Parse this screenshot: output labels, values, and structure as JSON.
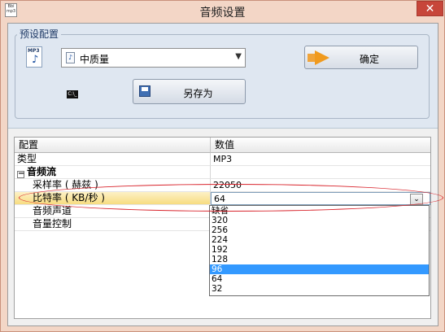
{
  "window": {
    "title": "音频设置",
    "app_icon_text": "Bbi mp3",
    "close_symbol": "✕"
  },
  "preset": {
    "group_label": "预设配置",
    "mp3_icon_text": "MP3",
    "selected": "中质量",
    "confirm_label": "确定",
    "save_as_label": "另存为",
    "cmd_icon_text": "C:\\_"
  },
  "grid": {
    "headers": {
      "config": "配置",
      "value": "数值"
    },
    "rows": [
      {
        "label": "类型",
        "value": "MP3"
      },
      {
        "label": "音频流",
        "value": "",
        "expander": "−"
      },
      {
        "label": "采样率 ( 赫兹 )",
        "value": "22050"
      },
      {
        "label": "比特率 ( KB/秒 )",
        "value": "64"
      },
      {
        "label": "音频声道",
        "value": ""
      },
      {
        "label": "音量控制",
        "value": ""
      }
    ]
  },
  "bitrate_dropdown": {
    "options": [
      "缺省",
      "320",
      "256",
      "224",
      "192",
      "128",
      "96",
      "64",
      "32"
    ],
    "highlighted": "96",
    "arrow": "⌄"
  },
  "colors": {
    "title_bar": "#f3d6c6",
    "close_button": "#c7463a",
    "panel": "#dfe7f1",
    "selected_row": "#f7dc80",
    "highlight": "#3399ff",
    "annotation": "#d9262e"
  }
}
